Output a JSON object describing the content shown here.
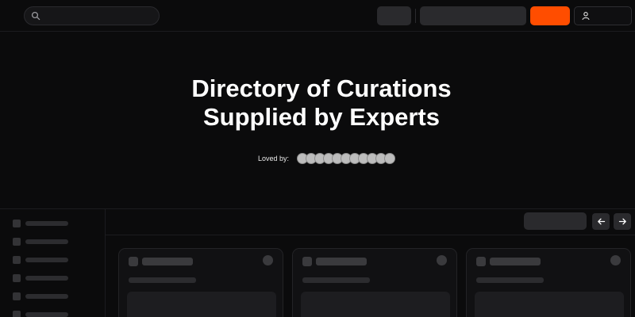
{
  "hero": {
    "title_line1": "Directory of Curations",
    "title_line2": "Supplied by Experts",
    "loved_by_label": "Loved by:",
    "avatar_count": 11
  },
  "icons": {
    "search": "search-icon",
    "user": "user-icon",
    "prev": "arrow-left-icon",
    "next": "arrow-right-icon"
  },
  "colors": {
    "background": "#0b0b0c",
    "accent": "#ff4d00",
    "text": "#ffffff",
    "placeholder": "#2a2a2d"
  },
  "sidebar": {
    "item_count": 6
  },
  "cards": {
    "count": 3
  }
}
